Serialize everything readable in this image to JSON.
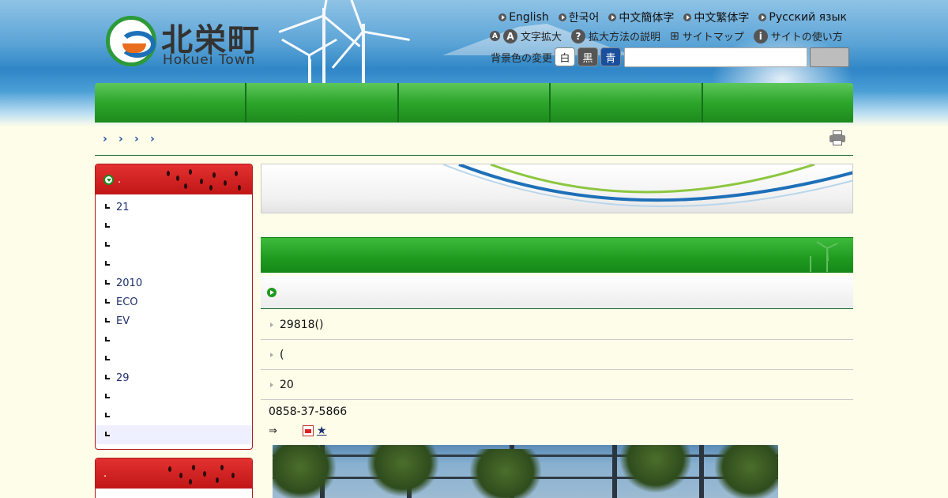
{
  "site": {
    "logo_jp": "北栄町",
    "logo_en": "Hokuei Town"
  },
  "languages": [
    "English",
    "한국어",
    "中文簡体字",
    "中文繁体字",
    "Русский язык"
  ],
  "tools": {
    "text_size": "文字拡大",
    "how_to_enlarge": "拡大方法の説明",
    "sitemap": "サイトマップ",
    "how_to_use": "サイトの使い方"
  },
  "background": {
    "label": "背景色の変更",
    "options": [
      "白",
      "黒",
      "青"
    ]
  },
  "search": {
    "placeholder": ""
  },
  "nav_items": [
    "",
    "",
    "",
    "",
    ""
  ],
  "breadcrumbs": [
    "›",
    "›",
    "›",
    "›"
  ],
  "sidebar": {
    "box1_title": ".",
    "items": [
      "21",
      "",
      "",
      "",
      "2010",
      "ECO",
      "EV",
      "",
      "",
      "29",
      "",
      "",
      ""
    ],
    "box2_title": "."
  },
  "main": {
    "news": [
      "29818()",
      "(",
      "20"
    ],
    "phone": "0858-37-5866",
    "arrow": "⇒",
    "star": "★"
  }
}
